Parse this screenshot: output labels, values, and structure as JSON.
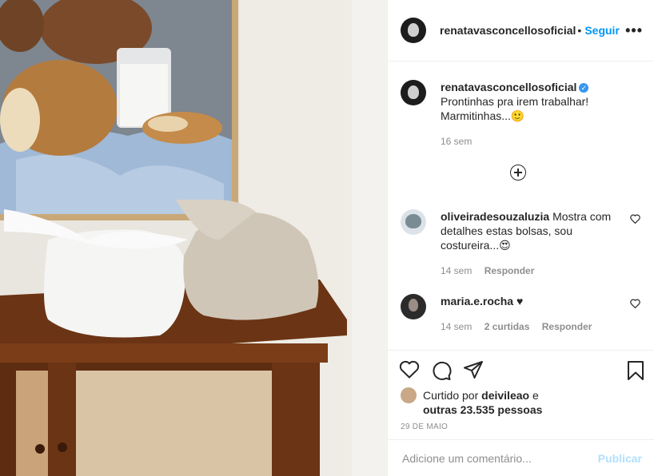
{
  "post": {
    "author": "renatavasconcellosoficial",
    "follow_label": "Seguir",
    "separator": "•",
    "more_label": "•••",
    "verified_mark": "✓",
    "caption_author": "renatavasconcellosoficial",
    "caption_line1": "Prontinhas pra irem trabalhar!",
    "caption_line2": "Marmitinhas...",
    "caption_emoji": "🙂",
    "caption_time": "16 sem"
  },
  "comments": [
    {
      "author": "oliveiradesouzaluzia",
      "text": "Mostra com detalhes estas bolsas, sou costureira...",
      "emoji": "😍",
      "time": "14 sem",
      "likes": "",
      "reply_label": "Responder"
    },
    {
      "author": "maria.e.rocha",
      "text": "",
      "emoji": "♥",
      "time": "14 sem",
      "likes": "2 curtidas",
      "reply_label": "Responder"
    }
  ],
  "likes": {
    "prefix": "Curtido por",
    "user": "deivileao",
    "connector": "e",
    "others": "outras 23.535 pessoas"
  },
  "date": "29 DE MAIO",
  "add_comment": {
    "placeholder": "Adicione um comentário...",
    "publish_label": "Publicar"
  },
  "colors": {
    "link": "#0095f6",
    "publish_disabled": "#b2dffc",
    "muted": "#8e8e8e"
  },
  "icons": [
    "heart-icon",
    "comment-icon",
    "share-icon",
    "bookmark-icon",
    "add-circle-icon",
    "more-icon",
    "verified-icon"
  ]
}
